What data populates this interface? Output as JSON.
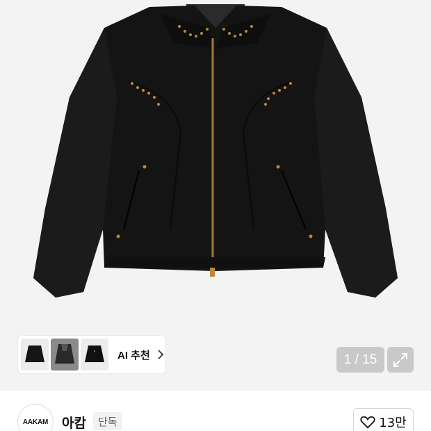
{
  "product": {
    "image_alt": "Black studded zip-up jacket",
    "ai_recommend": {
      "label": "AI 추천",
      "thumbnails": [
        "jacket-black-front",
        "jacket-grey-layered",
        "jacket-black-studded"
      ]
    },
    "image_counter": "1 / 15"
  },
  "brand": {
    "logo_text": "AAKAM",
    "name": "아캄",
    "badge": "단독"
  },
  "like": {
    "count": "13만"
  },
  "colors": {
    "hero_bg": "#f3f3f3",
    "counter_bg": "#c9c9c9",
    "jacket": "#141414",
    "studs": "#b8893a"
  }
}
